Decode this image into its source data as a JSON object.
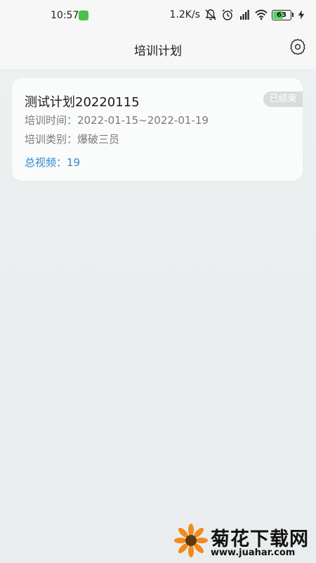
{
  "status_bar": {
    "time": "10:57",
    "net_speed": "1.2K/s",
    "battery_level": 63,
    "battery_text": "63",
    "icons": [
      "app-notification-icon",
      "mute-bell-icon",
      "alarm-icon",
      "hd-signal-icon",
      "wifi-icon",
      "battery-icon",
      "charging-icon"
    ]
  },
  "header": {
    "title": "培训计划",
    "settings_icon": "gear-icon"
  },
  "plans": [
    {
      "title": "测试计划20220115",
      "status": "已结束",
      "date_text": "培训时间：2022-01-15~2022-01-19",
      "category_text": "培训类别：爆破三员",
      "video_text": "总视频：19"
    }
  ],
  "watermark": {
    "name": "菊花下载网",
    "url": "www.juahar.com"
  },
  "colors": {
    "background": "#ecf0f1",
    "card": "#fafbfb",
    "accent": "#3288cc",
    "tag": "#d9dcdd",
    "battery": "#4cd964"
  }
}
